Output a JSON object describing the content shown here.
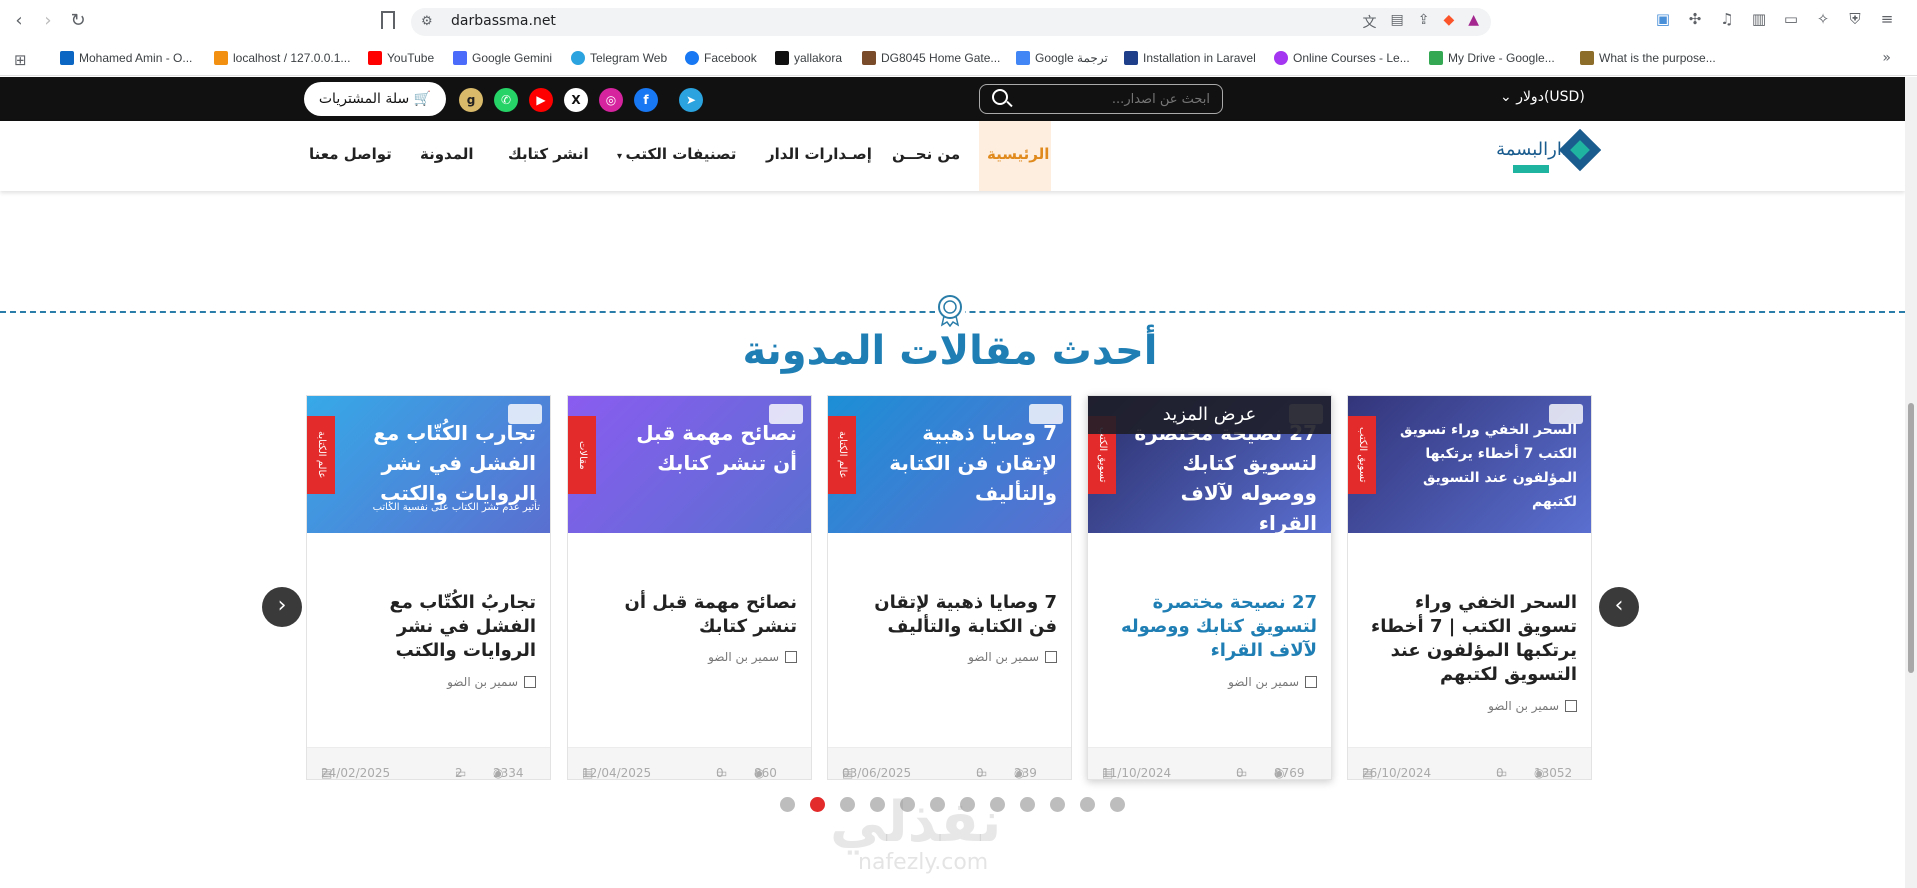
{
  "browser": {
    "url": "darbassma.net",
    "bookmarks": [
      {
        "label": "Mohamed Amin - O...",
        "color": "#0a66c2"
      },
      {
        "label": "localhost / 127.0.0.1...",
        "color": "#f29111"
      },
      {
        "label": "YouTube",
        "color": "#ff0000"
      },
      {
        "label": "Google Gemini",
        "color": "#4b6bfb"
      },
      {
        "label": "Telegram Web",
        "color": "#2aa3df"
      },
      {
        "label": "Facebook",
        "color": "#1877f2"
      },
      {
        "label": "yallakora",
        "color": "#111111"
      },
      {
        "label": "DG8045 Home Gate...",
        "color": "#7a4b2a"
      },
      {
        "label": "Google ترجمة",
        "color": "#4285f4"
      },
      {
        "label": "Installation in Laravel",
        "color": "#1f3f8a"
      },
      {
        "label": "Online Courses - Le...",
        "color": "#a435f0"
      },
      {
        "label": "My Drive - Google...",
        "color": "#34a853"
      },
      {
        "label": "What is the purpose...",
        "color": "#8c6d2a"
      }
    ]
  },
  "topbar": {
    "currency": "دولار(USD)",
    "search_placeholder": "ابحث عن اصدار...",
    "cart_label": "سلة المشتريات"
  },
  "nav": {
    "items": [
      "الرئيسية",
      "من نحــن",
      "إصـدارات الدار",
      "تصنيفات الكتب",
      "انشر كتابك",
      "المدونة",
      "تواصل معنا"
    ]
  },
  "section": {
    "title": "أحدث مقالات المدونة"
  },
  "cards": [
    {
      "ribbon": "تسويق الكتب",
      "img_text": "السحر الخفي وراء تسويق الكتب 7 أخطاء يرتكبها المؤلفون عند التسويق لكتبهم",
      "img_bg": "#33357a",
      "title": "السحر الخفي وراء تسويق الكتب | 7 أخطاء يرتكبها المؤلفون عند التسويق لكتبهم",
      "author": "سمير بن الضو",
      "views": "13052",
      "comments": "0",
      "date": "26/10/2024",
      "highlight": false
    },
    {
      "ribbon": "تسويق الكتب",
      "img_text": "27 نصيحة مختصرة لتسويق كتابك ووصوله لآلاف القراء",
      "img_bg": "#2b2f6b",
      "title": "27 نصيحة مختصرة لتسويق كتابك ووصوله لآلاف القراء",
      "author": "سمير بن الضو",
      "views": "8769",
      "comments": "0",
      "date": "11/10/2024",
      "highlight": true,
      "overlay": "عرض المزيد"
    },
    {
      "ribbon": "عالم الكتابة",
      "img_text": "7 وصايا ذهبية لإتقان فن الكتابة والتأليف",
      "img_bg": "#1c8fd6",
      "title": "7 وصايا ذهبية لإتقان فن الكتابة والتأليف",
      "author": "سمير بن الضو",
      "views": "239",
      "comments": "0",
      "date": "03/06/2025",
      "highlight": false
    },
    {
      "ribbon": "مقالات",
      "img_text": "نصائح مهمة قبل أن تنشر كتابك",
      "img_bg": "#8a5cf0",
      "title": "نصائح مهمة قبل أن تنشر كتابك",
      "author": "سمير بن الضو",
      "views": "860",
      "comments": "0",
      "date": "12/04/2025",
      "highlight": false
    },
    {
      "ribbon": "عالم الكتابة",
      "img_text": "تجارب الكُتّاب مع الفشل في نشر الروايات والكتب",
      "img_sub": "تأثير عدم نشر الكتاب على نفسية الكاتب",
      "img_bg": "#36a9e8",
      "title": "تجاربُ الكُتّاب مع الفشل في نشر الروايات والكتب",
      "author": "سمير بن الضو",
      "views": "2334",
      "comments": "2",
      "date": "24/02/2025",
      "highlight": false
    }
  ],
  "carousel": {
    "prev": "‹",
    "next": "›",
    "dots": 12,
    "active_dot": 1
  }
}
